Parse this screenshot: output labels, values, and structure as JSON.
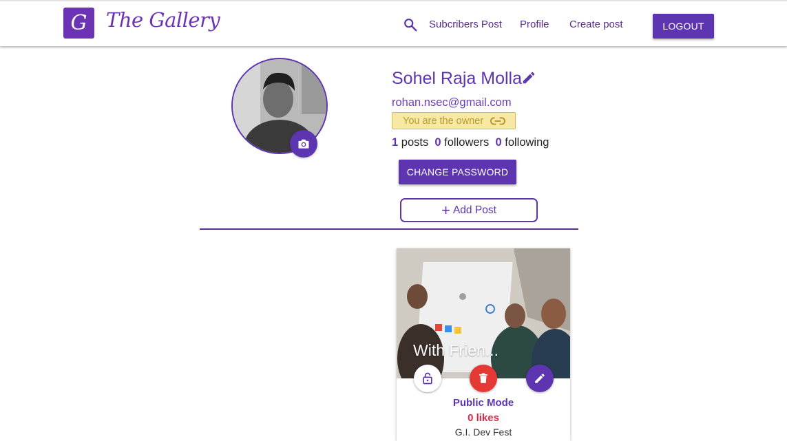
{
  "brand": {
    "logo_letter": "G",
    "name": "The Gallery"
  },
  "nav": {
    "search_icon": "search-icon",
    "links": [
      "Subcribers Post",
      "Profile",
      "Create post"
    ],
    "logout_label": "LOGOUT"
  },
  "profile": {
    "name": "Sohel Raja Molla",
    "email": "rohan.nsec@gmail.com",
    "owner_badge": "You are the owner",
    "stats": {
      "posts": "1",
      "posts_label": "posts",
      "followers": "0",
      "followers_label": "followers",
      "following": "0",
      "following_label": "following"
    },
    "change_password_label": "CHANGE PASSWORD",
    "add_post_label": "Add Post"
  },
  "post": {
    "title": "With Frien...",
    "mode": "Public Mode",
    "likes": "0 likes",
    "caption_partial": "G.I. Dev Fest"
  },
  "colors": {
    "primary": "#5e35b1",
    "delete": "#e53935",
    "likes": "#e0294a",
    "badge_bg": "#f7e8a4"
  }
}
